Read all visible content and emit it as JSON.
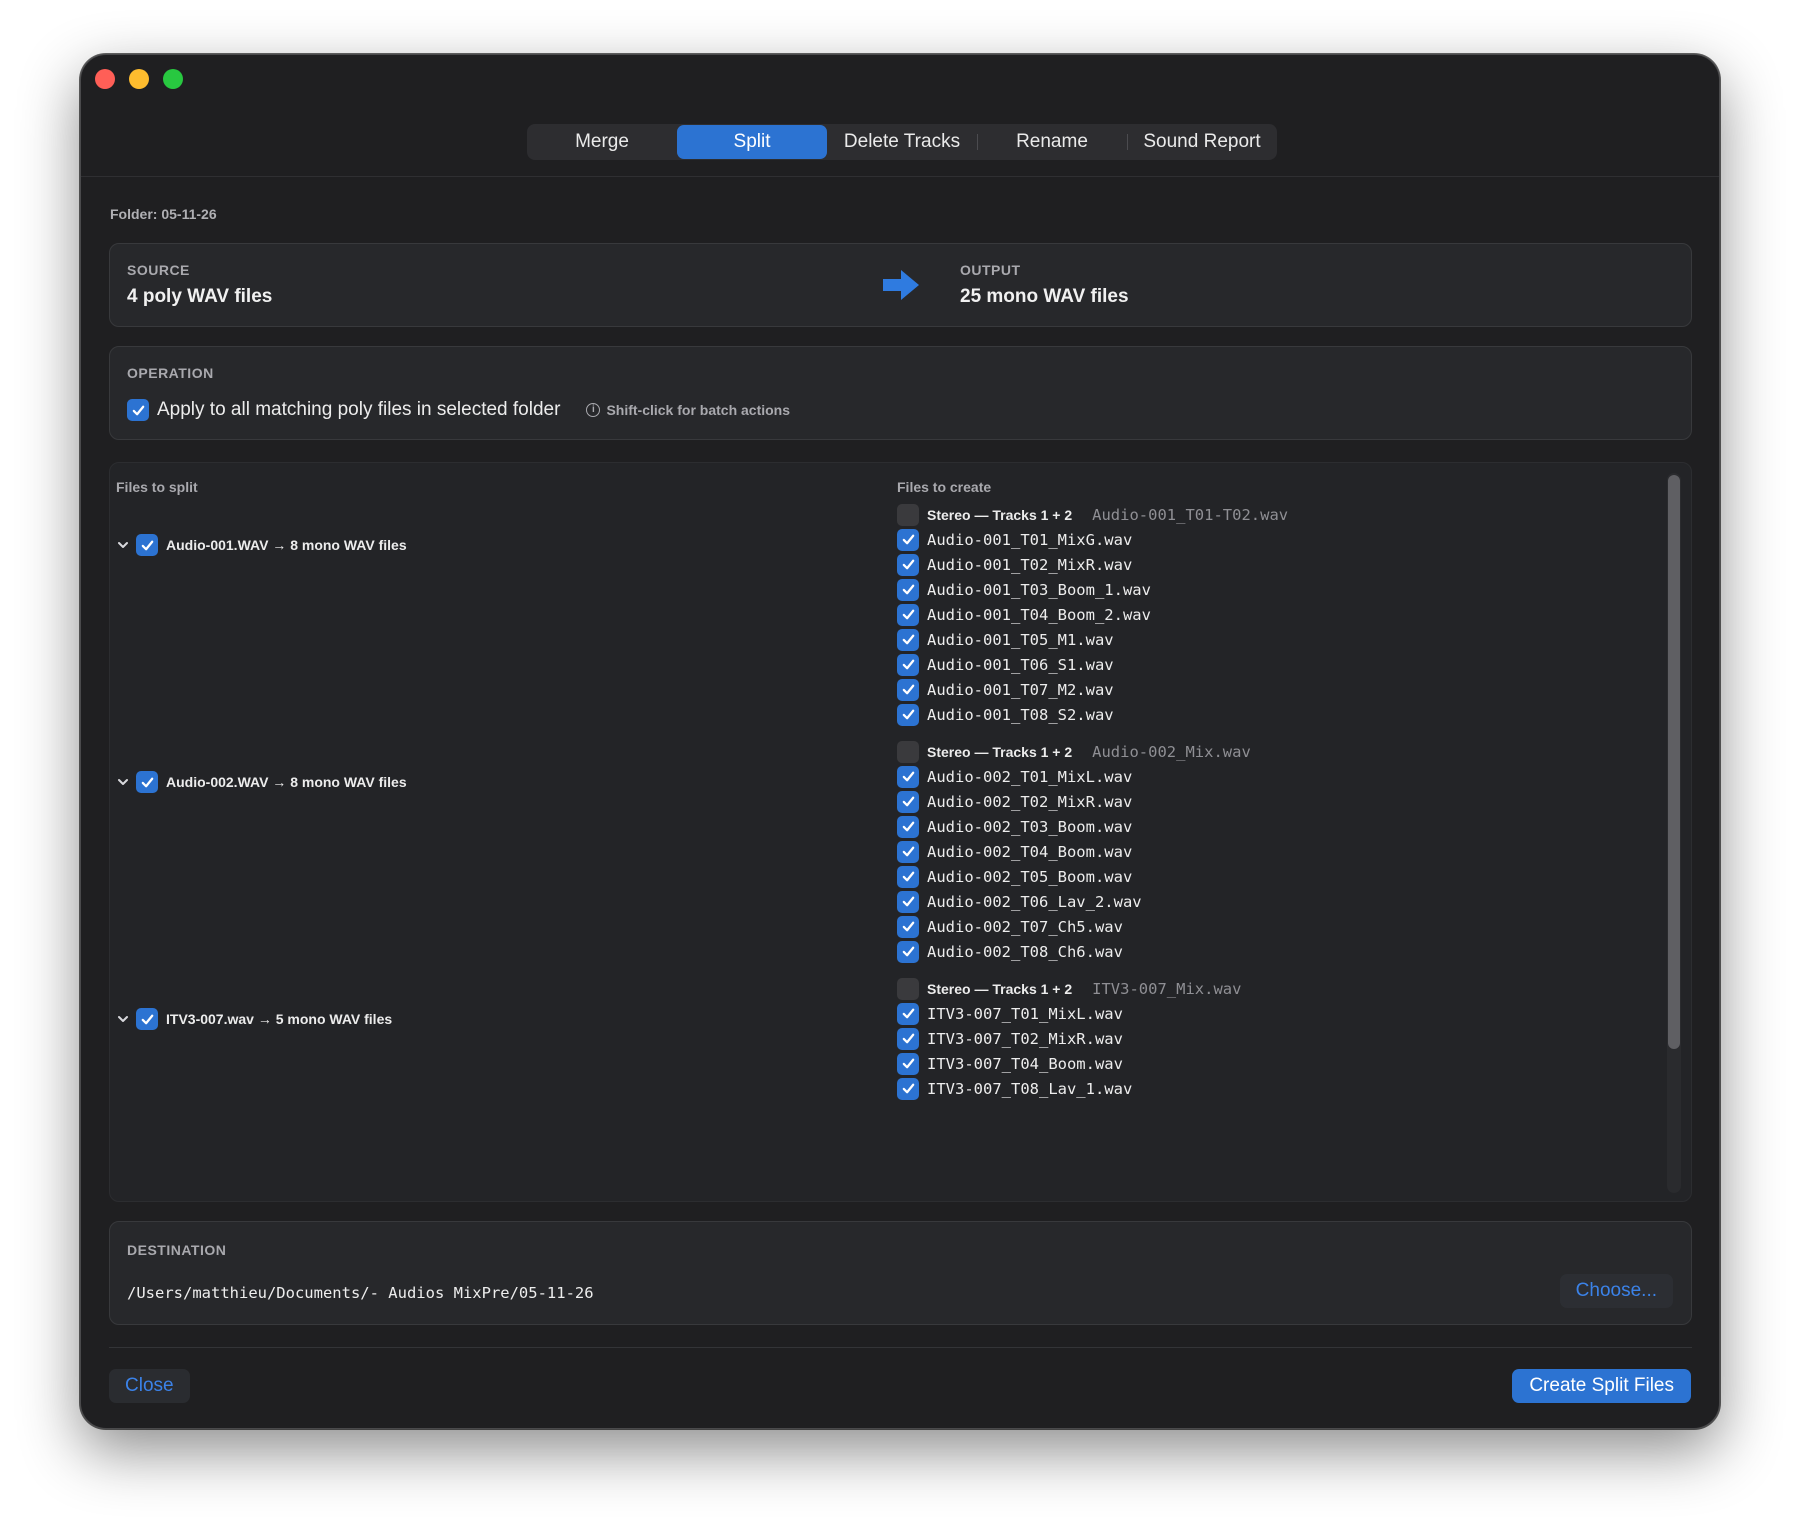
{
  "tabs": [
    {
      "label": "Merge",
      "active": false
    },
    {
      "label": "Split",
      "active": true
    },
    {
      "label": "Delete Tracks",
      "active": false
    },
    {
      "label": "Rename",
      "active": false
    },
    {
      "label": "Sound Report",
      "active": false
    }
  ],
  "folder": "Folder: 05-11-26",
  "source": {
    "label": "SOURCE",
    "value": "4 poly WAV files"
  },
  "output": {
    "label": "OUTPUT",
    "value": "25 mono WAV files"
  },
  "operation": {
    "label": "OPERATION",
    "apply_all_label": "Apply to all matching poly files in selected folder",
    "apply_all_checked": true,
    "hint": "Shift-click for batch actions"
  },
  "files": {
    "left_header": "Files to split",
    "right_header": "Files to create",
    "groups": [
      {
        "source": "Audio-001.WAV → 8 mono WAV files",
        "stereo_label": "Stereo — Tracks 1 + 2",
        "stereo_file": "Audio-001_T01-T02.wav",
        "outputs": [
          "Audio-001_T01_MixG.wav",
          "Audio-001_T02_MixR.wav",
          "Audio-001_T03_Boom_1.wav",
          "Audio-001_T04_Boom_2.wav",
          "Audio-001_T05_M1.wav",
          "Audio-001_T06_S1.wav",
          "Audio-001_T07_M2.wav",
          "Audio-001_T08_S2.wav"
        ]
      },
      {
        "source": "Audio-002.WAV → 8 mono WAV files",
        "stereo_label": "Stereo — Tracks 1 + 2",
        "stereo_file": "Audio-002_Mix.wav",
        "outputs": [
          "Audio-002_T01_MixL.wav",
          "Audio-002_T02_MixR.wav",
          "Audio-002_T03_Boom.wav",
          "Audio-002_T04_Boom.wav",
          "Audio-002_T05_Boom.wav",
          "Audio-002_T06_Lav_2.wav",
          "Audio-002_T07_Ch5.wav",
          "Audio-002_T08_Ch6.wav"
        ]
      },
      {
        "source": "ITV3-007.wav → 5 mono WAV files",
        "stereo_label": "Stereo — Tracks 1 + 2",
        "stereo_file": "ITV3-007_Mix.wav",
        "outputs": [
          "ITV3-007_T01_MixL.wav",
          "ITV3-007_T02_MixR.wav",
          "ITV3-007_T04_Boom.wav",
          "ITV3-007_T08_Lav_1.wav"
        ]
      }
    ]
  },
  "destination": {
    "label": "DESTINATION",
    "path": "/Users/matthieu/Documents/- Audios MixPre/05-11-26",
    "choose_label": "Choose..."
  },
  "footer": {
    "close_label": "Close",
    "create_label": "Create Split Files"
  },
  "colors": {
    "accent": "#2c73d2",
    "link": "#3b82e8",
    "window_bg": "#1f1f21",
    "panel_bg": "#27282b"
  },
  "icons": {
    "checkbox": "checkmark-icon",
    "disclosure": "chevron-down-icon",
    "arrow": "arrow-right-icon",
    "info": "info-icon"
  }
}
